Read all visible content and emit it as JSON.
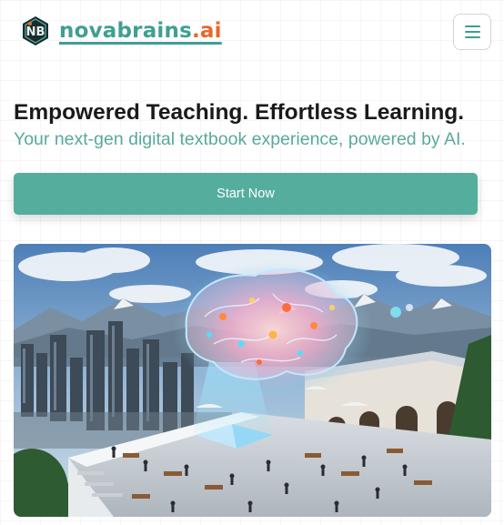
{
  "header": {
    "logo_mark": "NB",
    "brand_main": "novabrains",
    "brand_suffix": ".ai",
    "menu_icon": "hamburger-menu-icon"
  },
  "hero": {
    "title": "Empowered Teaching. Effortless Learning.",
    "subtitle": "Your next-gen digital textbook experience, powered by AI.",
    "cta_label": "Start Now"
  },
  "colors": {
    "accent": "#55ad9e",
    "brand_teal": "#3f9f92",
    "brand_orange": "#e56a2a",
    "title_text": "#1a1a1a"
  },
  "illustration": {
    "subject": "glowing-neural-brain-over-city-campus-illustration"
  }
}
